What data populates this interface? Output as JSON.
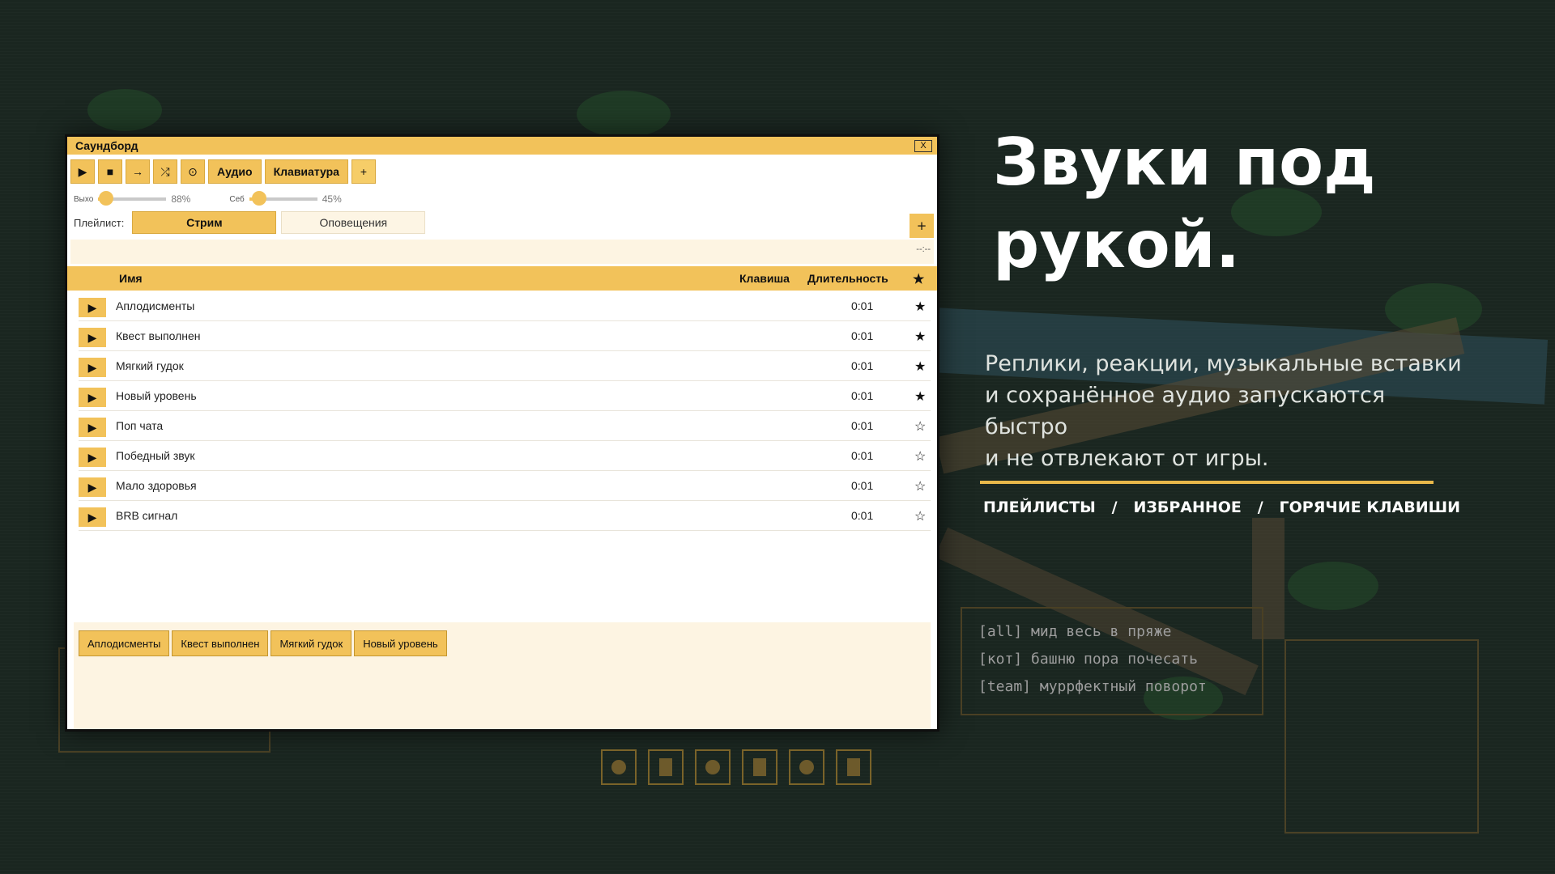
{
  "window": {
    "title": "Саундборд",
    "close_label": "X"
  },
  "toolbar": {
    "play_icon": "▶",
    "stop_icon": "■",
    "next_icon": "→",
    "shuffle_icon": "⤮",
    "record_icon": "⊙",
    "audio_label": "Аудио",
    "keyboard_label": "Клавиатура",
    "add_label": "+"
  },
  "sliders": {
    "output_label": "Выхо",
    "output_value": 0.88,
    "output_pct": "88%",
    "self_label": "Себ",
    "self_value": 0.45,
    "self_pct": "45%"
  },
  "playlist": {
    "label": "Плейлист:",
    "tabs": [
      "Стрим",
      "Оповещения"
    ],
    "active": "Стрим",
    "add_label": "+"
  },
  "status": {
    "time": "--:--"
  },
  "table": {
    "headers": {
      "name": "Имя",
      "key": "Клавиша",
      "duration": "Длительность",
      "fav": "★"
    },
    "rows": [
      {
        "name": "Аплодисменты",
        "duration": "0:01",
        "fav": "★"
      },
      {
        "name": "Квест выполнен",
        "duration": "0:01",
        "fav": "★"
      },
      {
        "name": "Мягкий гудок",
        "duration": "0:01",
        "fav": "★"
      },
      {
        "name": "Новый уровень",
        "duration": "0:01",
        "fav": "★"
      },
      {
        "name": "Поп чата",
        "duration": "0:01",
        "fav": "☆"
      },
      {
        "name": "Победный звук",
        "duration": "0:01",
        "fav": "☆"
      },
      {
        "name": "Мало здоровья",
        "duration": "0:01",
        "fav": "☆"
      },
      {
        "name": "BRB сигнал",
        "duration": "0:01",
        "fav": "☆"
      }
    ],
    "play_icon": "▶"
  },
  "quick_buttons": [
    "Аплодисменты",
    "Квест выполнен",
    "Мягкий гудок",
    "Новый уровень"
  ],
  "hero": {
    "title_line1": "Звуки под",
    "title_line2": "рукой.",
    "desc_line1": "Реплики, реакции, музыкальные вставки",
    "desc_line2": "и сохранённое аудио запускаются быстро",
    "desc_line3": "и не отвлекают от игры.",
    "tags": "ПЛЕЙЛИСТЫ   /   ИЗБРАННОЕ   /   ГОРЯЧИЕ КЛАВИШИ"
  },
  "chat": {
    "lines": [
      "[all] мид весь в пряже",
      "[кот] башню пора почесать",
      "[team] муррфектный поворот"
    ]
  },
  "colors": {
    "accent": "#f2c25a",
    "background": "#1a2620"
  }
}
